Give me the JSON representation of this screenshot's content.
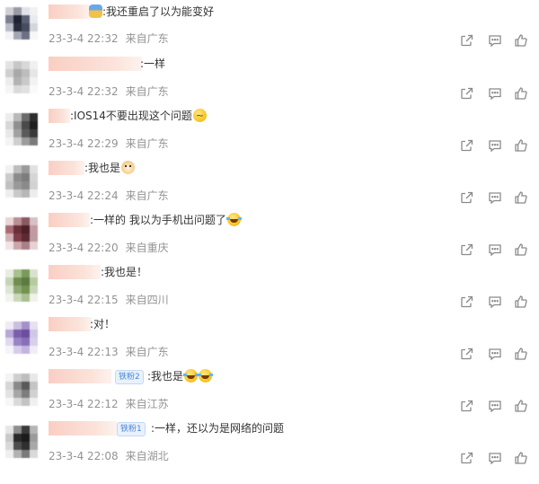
{
  "comments": [
    {
      "text": ":我还重启了以为能变好",
      "emoji_pre": "bulb",
      "time": "23-3-4 22:32",
      "location": "来自广东",
      "badge": "",
      "emoji": ""
    },
    {
      "text": ":一样",
      "time": "23-3-4 22:32",
      "location": "来自广东",
      "badge": "",
      "emoji": ""
    },
    {
      "text": ":IOS14不要出现这个问题",
      "time": "23-3-4 22:29",
      "location": "来自广东",
      "badge": "",
      "emoji": "think"
    },
    {
      "text": ":我也是",
      "time": "23-3-4 22:24",
      "location": "来自广东",
      "badge": "",
      "emoji": "dog"
    },
    {
      "text": ":一样的 我以为手机出问题了",
      "time": "23-3-4 22:20",
      "location": "来自重庆",
      "badge": "",
      "emoji": "laugh"
    },
    {
      "text": ":我也是！",
      "time": "23-3-4 22:15",
      "location": "来自四川",
      "badge": "",
      "emoji": ""
    },
    {
      "text": ":对！",
      "time": "23-3-4 22:13",
      "location": "来自广东",
      "badge": "",
      "emoji": ""
    },
    {
      "text": ":我也是",
      "time": "23-3-4 22:12",
      "location": "来自江苏",
      "badge": "铁粉2",
      "emoji": "laugh2"
    },
    {
      "text": ":一样，还以为是网络的问题",
      "time": "23-3-4 22:08",
      "location": "来自湖北",
      "badge": "铁粉1",
      "emoji": ""
    }
  ],
  "icons": {
    "share": "share-icon",
    "comment": "comment-icon",
    "like": "like-icon"
  },
  "colors": {
    "meta": "#939393",
    "badge": "#4a86d4",
    "nick_blur": "#f9c9bd"
  }
}
